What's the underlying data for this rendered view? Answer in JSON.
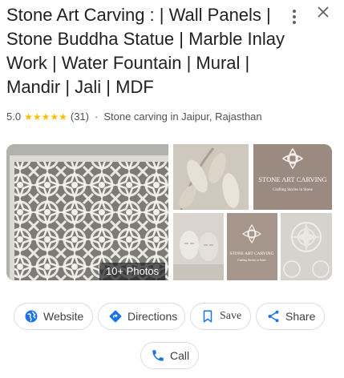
{
  "listing": {
    "title": "Stone Art Carving : | Wall Panels | Stone Buddha Statue | Marble Inlay Work | Water Fountain | Mural | Mandir | Jali | MDF",
    "rating": "5.0",
    "stars": "★★★★★",
    "review_count": "(31)",
    "separator": "·",
    "category": "Stone carving in Jaipur, Rajasthan"
  },
  "photos": {
    "badge": "10+ Photos",
    "brand_name": "STONE ART CARVING",
    "brand_tagline": "Crafting Stories in Stone"
  },
  "actions": {
    "website": "Website",
    "directions": "Directions",
    "save": "Save",
    "share": "Share",
    "call": "Call"
  },
  "colors": {
    "star": "#fbbc04",
    "link_blue": "#1a73e8",
    "chip_border": "#dadce0"
  },
  "icons": [
    "more-vert-icon",
    "close-icon",
    "globe-icon",
    "directions-icon",
    "bookmark-icon",
    "share-icon",
    "phone-icon"
  ]
}
